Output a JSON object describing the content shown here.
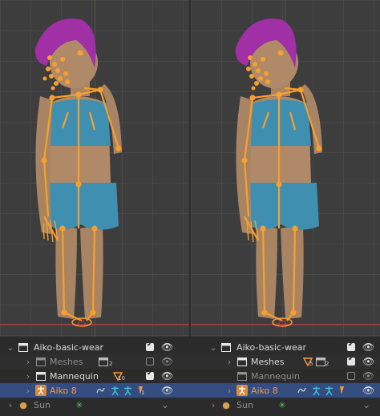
{
  "outliner_left": {
    "rows": [
      {
        "label": "Aiko-basic-wear"
      },
      {
        "label": "Meshes",
        "badge": "2"
      },
      {
        "label": "Mannequin",
        "badge": "10"
      },
      {
        "label": "Aiko 8",
        "badge": "1"
      },
      {
        "label": "Sun"
      }
    ]
  },
  "outliner_right": {
    "rows": [
      {
        "label": "Aiko-basic-wear"
      },
      {
        "label": "Meshes",
        "badge_a": "5",
        "badge_b": "2"
      },
      {
        "label": "Mannequin"
      },
      {
        "label": "Aiko 8"
      },
      {
        "label": "Sun"
      }
    ]
  },
  "colors": {
    "bone": "#f7a02e",
    "selection": "#334d80",
    "hair": "#a12fa5",
    "skin": "#b08a68",
    "clothing": "#3f8fb0",
    "axis_red": "#9a3b3b"
  },
  "icons": [
    "collection-icon",
    "eye-icon",
    "checkbox-icon",
    "armature-icon",
    "pose-icon",
    "light-icon",
    "mesh-icon"
  ]
}
